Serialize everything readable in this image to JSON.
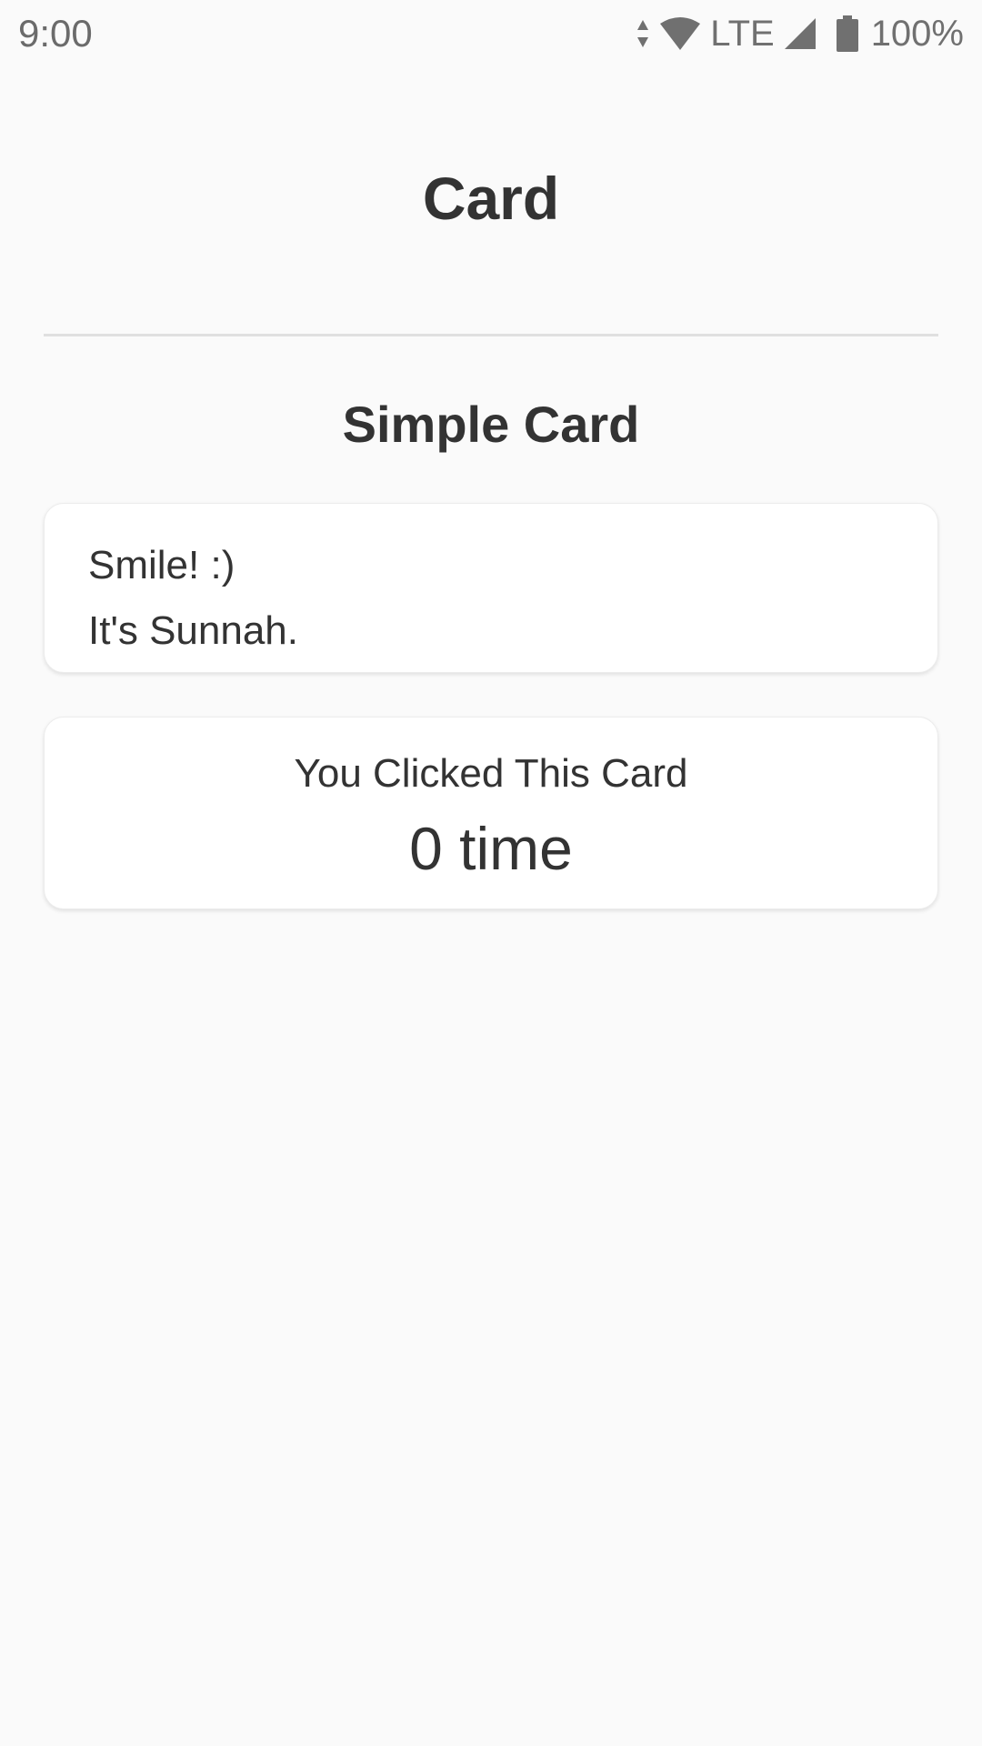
{
  "status_bar": {
    "time": "9:00",
    "network": "LTE",
    "battery": "100%",
    "icons": [
      "data-arrows-icon",
      "wifi-icon",
      "cell-signal-icon",
      "battery-icon"
    ]
  },
  "header": {
    "title": "Card"
  },
  "section": {
    "title": "Simple Card"
  },
  "simple_card": {
    "line1": "Smile! :)",
    "line2": "It's Sunnah."
  },
  "click_card": {
    "label": "You Clicked This Card",
    "count_text": "0 time"
  },
  "colors": {
    "background": "#fafafa",
    "text": "#333333",
    "card": "#ffffff",
    "divider": "#e0e0e0"
  }
}
